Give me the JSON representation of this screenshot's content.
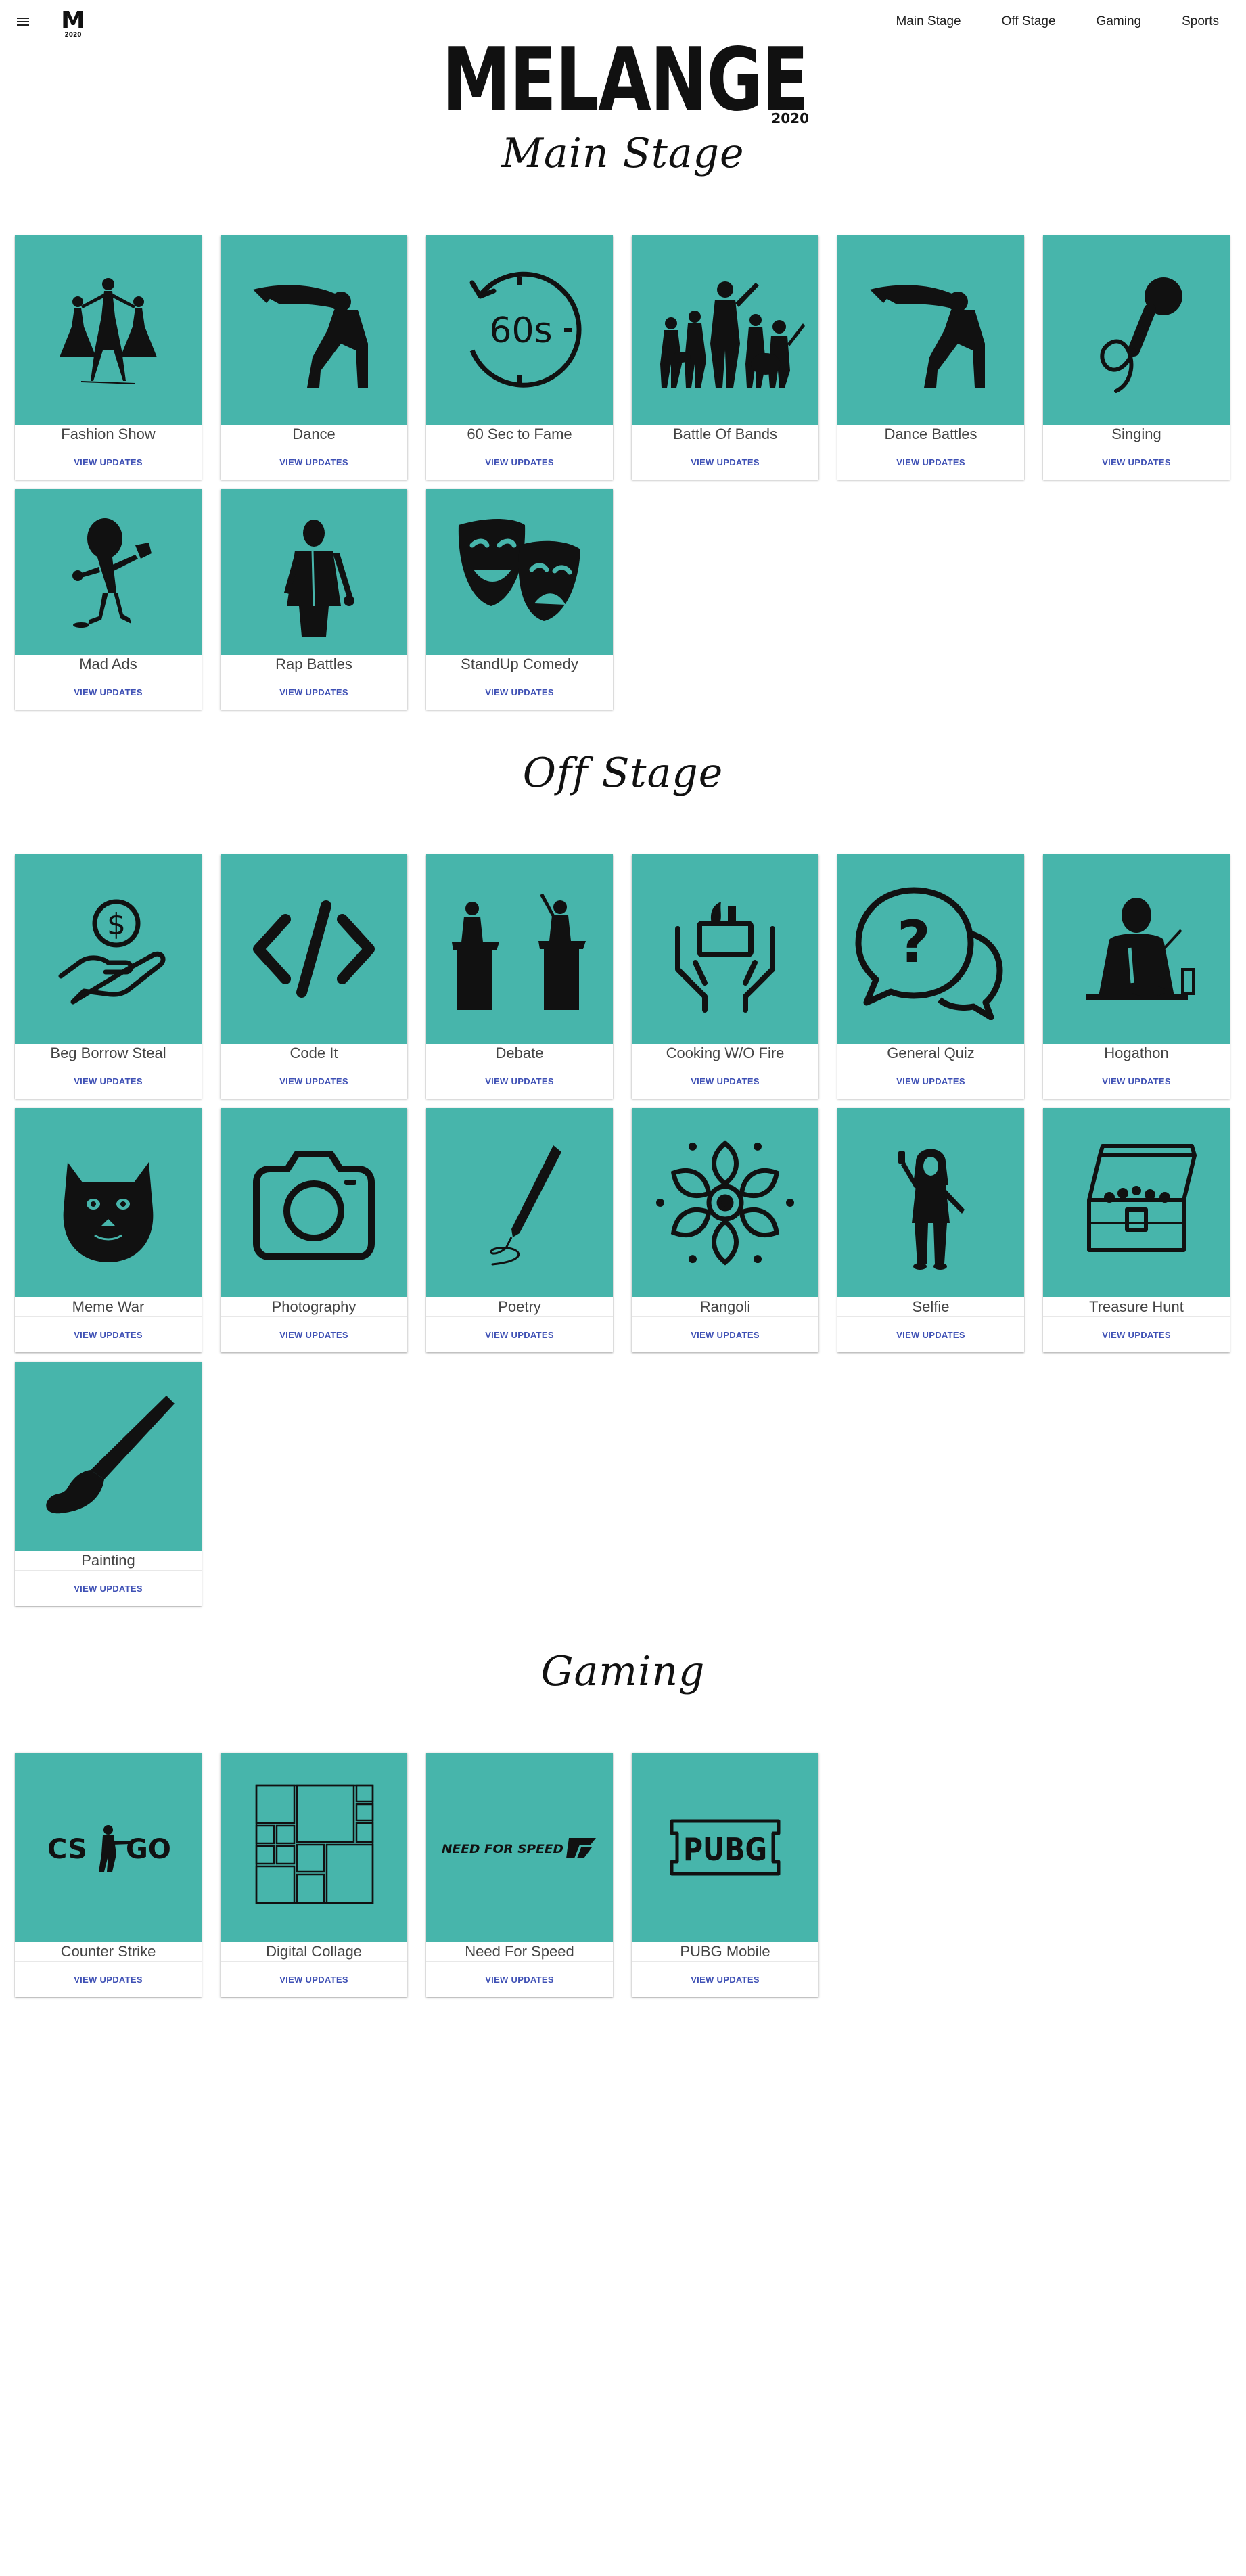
{
  "header": {
    "menu_icon": "hamburger-icon",
    "small_logo_letter": "M",
    "small_logo_year": "2020",
    "nav": [
      "Main Stage",
      "Off Stage",
      "Gaming",
      "Sports"
    ]
  },
  "logo": {
    "text": "MELANGE",
    "year": "2020"
  },
  "theme": {
    "card_color": "#47b5ab",
    "action_color": "#3f51b5",
    "icon_color": "#111111"
  },
  "sections": {
    "main_stage": {
      "title": "Main Stage",
      "cards": [
        {
          "label": "Fashion Show",
          "icon": "fashion-models-icon",
          "action": "VIEW UPDATES"
        },
        {
          "label": "Dance",
          "icon": "breakdancer-icon",
          "action": "VIEW UPDATES"
        },
        {
          "label": "60 Sec to Fame",
          "icon": "timer-60s-icon",
          "action": "VIEW UPDATES",
          "icon_text": "60s"
        },
        {
          "label": "Battle Of Bands",
          "icon": "band-silhouette-icon",
          "action": "VIEW UPDATES"
        },
        {
          "label": "Dance Battles",
          "icon": "breakdancer-icon",
          "action": "VIEW UPDATES"
        },
        {
          "label": "Singing",
          "icon": "microphone-icon",
          "action": "VIEW UPDATES"
        },
        {
          "label": "Mad Ads",
          "icon": "cartoon-character-icon",
          "action": "VIEW UPDATES"
        },
        {
          "label": "Rap Battles",
          "icon": "rapper-icon",
          "action": "VIEW UPDATES"
        },
        {
          "label": "StandUp Comedy",
          "icon": "theatre-masks-icon",
          "action": "VIEW UPDATES"
        }
      ]
    },
    "off_stage": {
      "title": "Off Stage",
      "cards": [
        {
          "label": "Beg Borrow Steal",
          "icon": "hand-coin-icon",
          "action": "VIEW UPDATES"
        },
        {
          "label": "Code It",
          "icon": "code-brackets-icon",
          "action": "VIEW UPDATES"
        },
        {
          "label": "Debate",
          "icon": "podium-speakers-icon",
          "action": "VIEW UPDATES"
        },
        {
          "label": "Cooking W/O Fire",
          "icon": "hands-food-icon",
          "action": "VIEW UPDATES"
        },
        {
          "label": "General Quiz",
          "icon": "question-bubbles-icon",
          "action": "VIEW UPDATES"
        },
        {
          "label": "Hogathon",
          "icon": "man-eating-icon",
          "action": "VIEW UPDATES"
        },
        {
          "label": "Meme War",
          "icon": "doge-icon",
          "action": "VIEW UPDATES"
        },
        {
          "label": "Photography",
          "icon": "camera-icon",
          "action": "VIEW UPDATES"
        },
        {
          "label": "Poetry",
          "icon": "pen-icon",
          "action": "VIEW UPDATES"
        },
        {
          "label": "Rangoli",
          "icon": "mandala-icon",
          "action": "VIEW UPDATES"
        },
        {
          "label": "Selfie",
          "icon": "selfie-girl-icon",
          "action": "VIEW UPDATES"
        },
        {
          "label": "Treasure Hunt",
          "icon": "treasure-chest-icon",
          "action": "VIEW UPDATES"
        },
        {
          "label": "Painting",
          "icon": "paintbrush-icon",
          "action": "VIEW UPDATES"
        }
      ]
    },
    "gaming": {
      "title": "Gaming",
      "cards": [
        {
          "label": "Counter Strike",
          "icon": "csgo-logo-icon",
          "action": "VIEW UPDATES",
          "icon_text_a": "CS",
          "icon_text_b": "GO"
        },
        {
          "label": "Digital Collage",
          "icon": "collage-grid-icon",
          "action": "VIEW UPDATES"
        },
        {
          "label": "Need For Speed",
          "icon": "nfs-logo-icon",
          "action": "VIEW UPDATES",
          "icon_text": "NEED FOR SPEED"
        },
        {
          "label": "PUBG Mobile",
          "icon": "pubg-logo-icon",
          "action": "VIEW UPDATES",
          "icon_text": "PUBG"
        }
      ]
    }
  }
}
